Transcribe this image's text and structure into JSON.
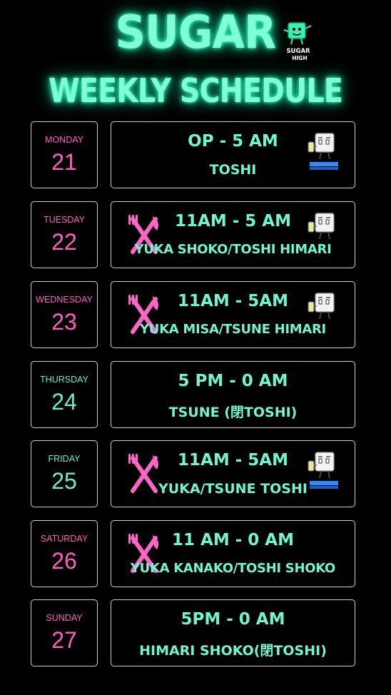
{
  "header": {
    "title": "SUGAR",
    "subtitle": "WEEKLY SCHEDULE",
    "logo_text_top": "SUGAR",
    "logo_text_bottom": "HIGH"
  },
  "colors": {
    "accent_cyan": "#6ff5d2",
    "accent_pink": "#ff5ec0",
    "border": "#cfcfcf",
    "background": "#000000"
  },
  "days": [
    {
      "day": "MONDAY",
      "date": "21",
      "time": "OP - 5 AM",
      "staff": "TOSHI",
      "fork_icon": false,
      "mascot_icon": true
    },
    {
      "day": "TUESDAY",
      "date": "22",
      "time": "11AM - 5 AM",
      "staff": "YUKA SHOKO/TOSHI HIMARI",
      "fork_icon": true,
      "mascot_icon": true
    },
    {
      "day": "WEDNESDAY",
      "date": "23",
      "time": "11AM - 5AM",
      "staff": "YUKA MISA/TSUNE HIMARI",
      "fork_icon": true,
      "mascot_icon": true
    },
    {
      "day": "THURSDAY",
      "date": "24",
      "time": "5 PM - 0 AM",
      "staff": "TSUNE (閉TOSHI)",
      "fork_icon": false,
      "mascot_icon": false
    },
    {
      "day": "FRIDAY",
      "date": "25",
      "time": "11AM - 5AM",
      "staff": "YUKA/TSUNE TOSHI",
      "fork_icon": true,
      "mascot_icon": true
    },
    {
      "day": "SATURDAY",
      "date": "26",
      "time": "11 AM - 0 AM",
      "staff": "YUKA KANAKO/TOSHI SHOKO",
      "fork_icon": true,
      "mascot_icon": false
    },
    {
      "day": "SUNDAY",
      "date": "27",
      "time": "5PM - 0 AM",
      "staff": "HIMARI SHOKO(閉TOSHI)",
      "fork_icon": false,
      "mascot_icon": false
    }
  ]
}
